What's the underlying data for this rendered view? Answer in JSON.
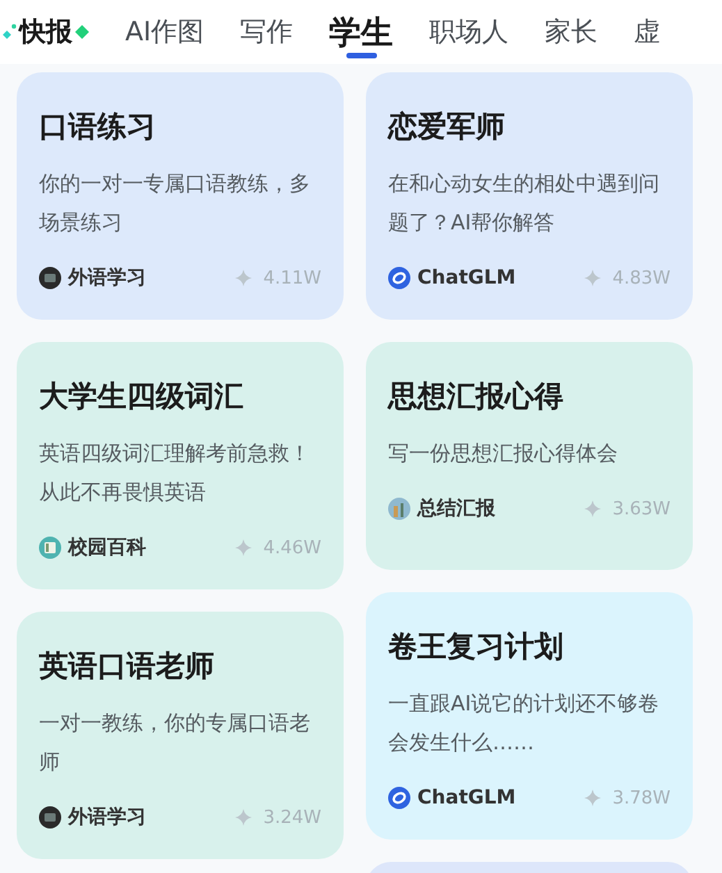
{
  "tabs": [
    {
      "label": "快报",
      "kind": "flash",
      "selected": false
    },
    {
      "label": "AI作图",
      "kind": "plain",
      "selected": false
    },
    {
      "label": "写作",
      "kind": "plain",
      "selected": false
    },
    {
      "label": "学生",
      "kind": "plain",
      "selected": true
    },
    {
      "label": "职场人",
      "kind": "plain",
      "selected": false
    },
    {
      "label": "家长",
      "kind": "plain",
      "selected": false
    },
    {
      "label": "虚",
      "kind": "plain",
      "selected": false
    }
  ],
  "columns": [
    [
      {
        "title": "口语练习",
        "description": "你的一对一专属口语教练，多场景练习",
        "color": "#dde9fb",
        "source": {
          "name": "外语学习",
          "kind": "monitor"
        },
        "count": "4.11W"
      },
      {
        "title": "大学生四级词汇",
        "description": "英语四级词汇理解考前急救！从此不再畏惧英语",
        "color": "#d8f1ec",
        "source": {
          "name": "校园百科",
          "kind": "book"
        },
        "count": "4.46W"
      },
      {
        "title": "英语口语老师",
        "description": "一对一教练，你的专属口语老师",
        "color": "#d8f1ec",
        "source": {
          "name": "外语学习",
          "kind": "monitor"
        },
        "count": "3.24W"
      }
    ],
    [
      {
        "title": "恋爱军师",
        "description": "在和心动女生的相处中遇到问题了？AI帮你解答",
        "color": "#dde9fb",
        "source": {
          "name": "ChatGLM",
          "kind": "ring"
        },
        "count": "4.83W"
      },
      {
        "title": "思想汇报心得",
        "description": "写一份思想汇报心得体会",
        "color": "#d8f1ec",
        "source": {
          "name": "总结汇报",
          "kind": "photo"
        },
        "count": "3.63W"
      },
      {
        "title": "卷王复习计划",
        "description": "一直跟AI说它的计划还不够卷会发生什么……",
        "color": "#dbf4fd",
        "source": {
          "name": "ChatGLM",
          "kind": "ring"
        },
        "count": "3.78W"
      },
      {
        "color": "#dde6fa"
      }
    ]
  ]
}
